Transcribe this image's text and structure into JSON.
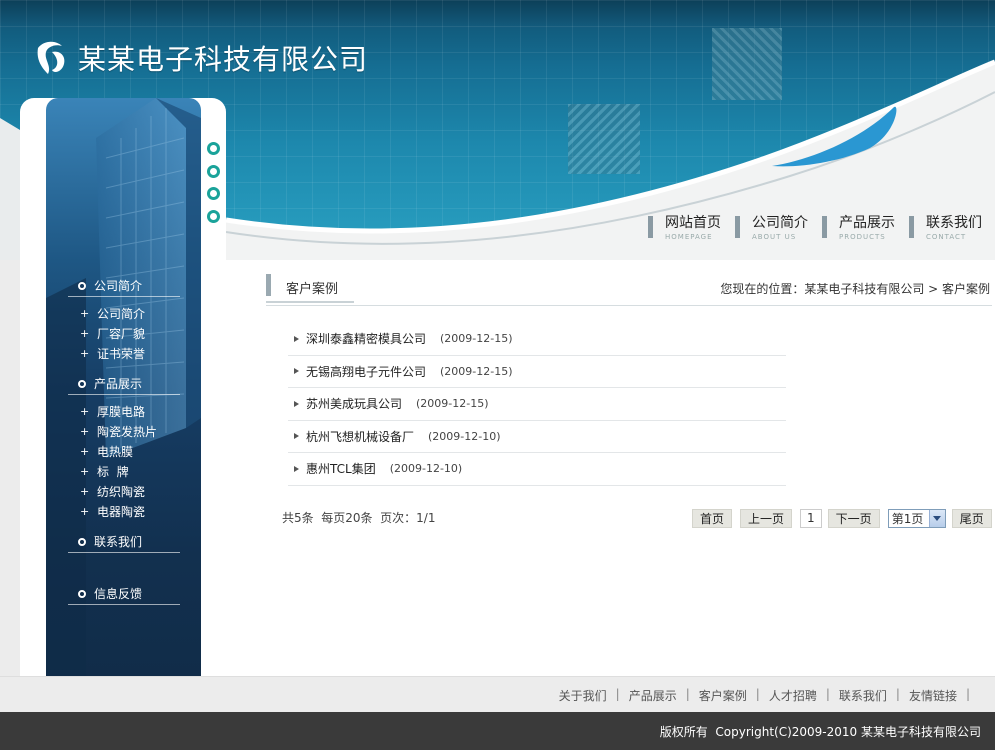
{
  "site": {
    "title": "某某电子科技有限公司"
  },
  "topnav": [
    {
      "label": "网站首页",
      "sub": "HOMEPAGE"
    },
    {
      "label": "公司简介",
      "sub": "ABOUT US"
    },
    {
      "label": "产品展示",
      "sub": "PRODUCTS"
    },
    {
      "label": "联系我们",
      "sub": "CONTACT"
    }
  ],
  "sidebar": {
    "sections": [
      {
        "label": "公司简介",
        "items": [
          "公司简介",
          "厂容厂貌",
          "证书荣誉"
        ]
      },
      {
        "label": "产品展示",
        "items": [
          "厚膜电路",
          "陶瓷发热片",
          "电热膜",
          "标  牌",
          "纺织陶瓷",
          "电器陶瓷"
        ]
      },
      {
        "label": "联系我们",
        "items": []
      },
      {
        "label": "信息反馈",
        "items": []
      }
    ]
  },
  "content": {
    "heading": "客户案例",
    "location": "您现在的位置：某某电子科技有限公司 > 客户案例",
    "cases": [
      {
        "name": "深圳泰鑫精密模具公司",
        "date": "(2009-12-15)"
      },
      {
        "name": "无锡高翔电子元件公司",
        "date": "(2009-12-15)"
      },
      {
        "name": "苏州美成玩具公司",
        "date": "(2009-12-15)"
      },
      {
        "name": "杭州飞想机械设备厂",
        "date": "(2009-12-10)"
      },
      {
        "name": "惠州TCL集团",
        "date": "(2009-12-10)"
      }
    ],
    "summary": "共5条  每页20条  页次：1/1",
    "pager": {
      "first": "首页",
      "prev": "上一页",
      "current": "1",
      "next": "下一页",
      "select": "第1页",
      "last": "尾页"
    }
  },
  "footer": {
    "links": [
      "关于我们",
      "产品展示",
      "客户案例",
      "人才招聘",
      "联系我们",
      "友情链接"
    ],
    "copyright": "版权所有  Copyright(C)2009-2010 某某电子科技有限公司"
  },
  "colors": {
    "primary": "#1d88ad",
    "accent": "#1aa39a",
    "footer": "#3a3a3a"
  },
  "icons": [
    "logo-icon",
    "circle-bullet-icon",
    "plus-icon",
    "triangle-bullet-icon",
    "chevron-down-icon"
  ]
}
